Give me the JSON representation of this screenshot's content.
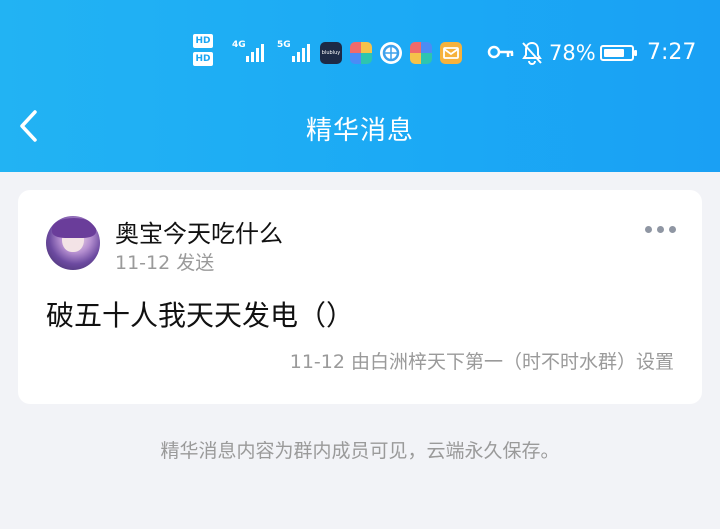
{
  "statusbar": {
    "hd1": "HD",
    "hd2": "HD",
    "net1": "4G",
    "net2": "5G",
    "app_icon_text": "blubluy",
    "battery_percent": "78%",
    "battery_level": 0.78,
    "time": "7:27"
  },
  "header": {
    "title": "精华消息"
  },
  "card": {
    "sender_name": "奥宝今天吃什么",
    "send_time": "11-12 发送",
    "content": "破五十人我天天发电（）",
    "set_info": "11-12 由白洲梓天下第一（时不时水群）设置"
  },
  "footer_note": "精华消息内容为群内成员可见，云端永久保存。",
  "colors": {
    "header_blue": "#1ba9f5",
    "page_bg": "#f2f3f7",
    "card_bg": "#ffffff",
    "secondary_text": "#9a9a9a"
  }
}
